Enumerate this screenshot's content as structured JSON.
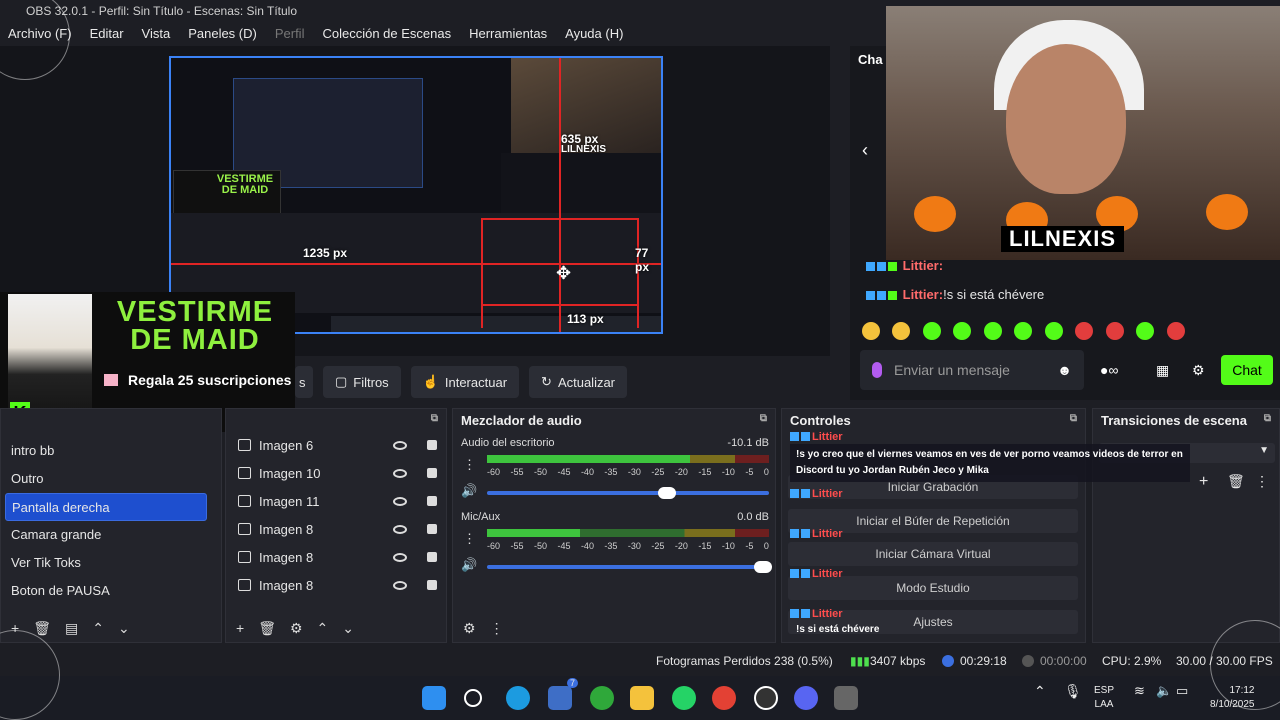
{
  "window": {
    "title": "OBS 32.0.1 - Perfil: Sin Título - Escenas: Sin Título"
  },
  "menu": [
    "Archivo (F)",
    "Editar",
    "Vista",
    "Paneles (D)",
    "Perfil",
    "Colección de Escenas",
    "Herramientas",
    "Ayuda (H)"
  ],
  "preview": {
    "measure_top": "635 px",
    "measure_left": "1235 px",
    "measure_right": "77 px",
    "measure_bottom": "113 px",
    "streamer": "LILNEXIS",
    "maid_small": "VESTIRME DE MAID"
  },
  "maid_overlay": {
    "title": "VESTIRME DE MAID",
    "subtitle": "Regala 25 suscripciones",
    "logo": "K"
  },
  "toolbar": {
    "filters": "Filtros",
    "interact": "Interactuar",
    "refresh": "Actualizar"
  },
  "scenes": {
    "items": [
      "intro bb",
      "Outro",
      "Pantalla derecha",
      "Camara grande",
      "Ver Tik Toks",
      "Boton de PAUSA"
    ],
    "active_index": 2
  },
  "sources": {
    "items": [
      "Imagen 6",
      "Imagen 10",
      "Imagen 11",
      "Imagen 8",
      "Imagen 8",
      "Imagen 8"
    ]
  },
  "mixer": {
    "title": "Mezclador de audio",
    "channels": [
      {
        "name": "Audio del escritorio",
        "db": "-10.1 dB",
        "level": 0.72,
        "volume": 0.64
      },
      {
        "name": "Mic/Aux",
        "db": "0.0 dB",
        "level": 0.33,
        "volume": 0.98
      }
    ],
    "ticks": [
      "-60",
      "-55",
      "-50",
      "-45",
      "-40",
      "-35",
      "-30",
      "-25",
      "-20",
      "-15",
      "-10",
      "-5",
      "0"
    ]
  },
  "controls": {
    "title": "Controles",
    "buttons": [
      "Iniciar Grabación",
      "Iniciar el Búfer de Repetición",
      "Iniciar Cámara Virtual",
      "Modo Estudio",
      "Ajustes"
    ]
  },
  "transitions": {
    "title": "Transiciones de escena"
  },
  "chat_overlay": {
    "user": "Littier",
    "message1": "!s yo creo que el viernes veamos en ves de ver porno veamos videos de terror en Discord tu yo Jordan Rubén Jeco y Mika",
    "message2": "!s si está chévere"
  },
  "chat_panel": {
    "tab": "Cha",
    "streamer": "LILNEXIS",
    "line1_user": "Littier:",
    "line2_user": "Littier:",
    "line2_text": "!s si está chévere",
    "placeholder": "Enviar un mensaje",
    "chat_button": "Chat"
  },
  "status": {
    "dropped": "Fotogramas Perdidos 238 (0.5%)",
    "kbps": "3407 kbps",
    "live_time": "00:29:18",
    "rec_time": "00:00:00",
    "cpu": "CPU: 2.9%",
    "fps": "30.00 / 30.00 FPS"
  },
  "taskbar": {
    "lang1": "ESP",
    "lang2": "LAA",
    "time": "17:12",
    "date": "8/10/2025",
    "badge": "7"
  },
  "colors": {
    "accent": "#1e4fcf",
    "kick_green": "#53fc18",
    "live_red": "#e02424"
  }
}
